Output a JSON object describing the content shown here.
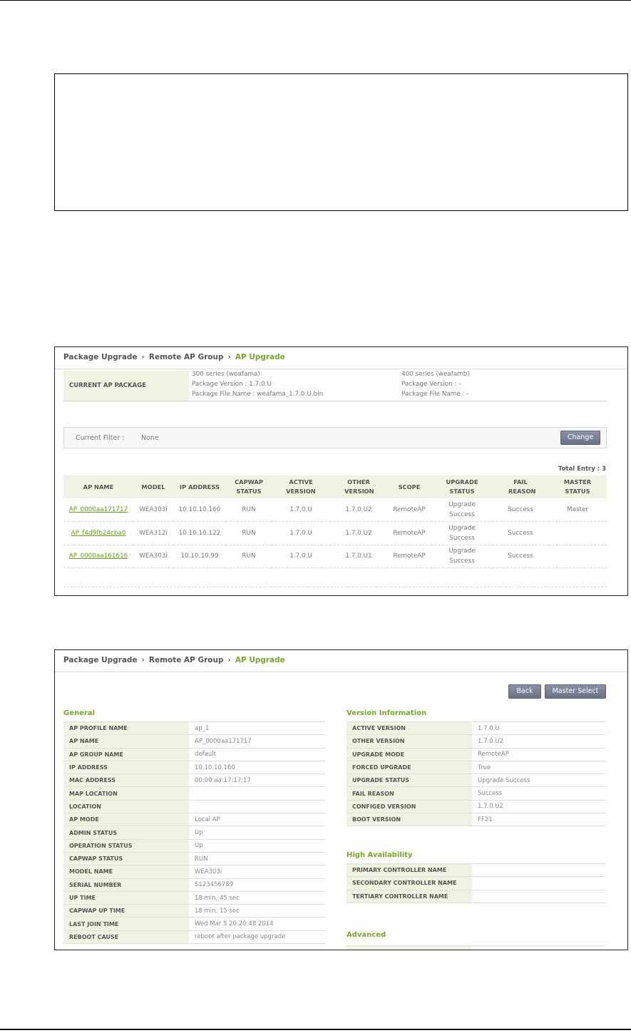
{
  "panel1": {
    "breadcrumb": [
      "Package Upgrade",
      "Remote AP Group",
      "AP Upgrade"
    ],
    "current_package_label": "CURRENT AP PACKAGE",
    "pkg300": [
      "300 series (weafama)",
      "Package Version : 1.7.0.U",
      "Package File Name : weafama_1.7.0.U.bin"
    ],
    "pkg400": [
      "400 series (weafamb)",
      "Package Version : -",
      "Package File Name : -"
    ],
    "filter_label": "Current Filter :",
    "filter_value": "None",
    "change_button": "Change",
    "total_entry": "Total Entry : 3",
    "columns": [
      "AP NAME",
      "MODEL",
      "IP ADDRESS",
      "CAPWAP STATUS",
      "ACTIVE VERSION",
      "OTHER VERSION",
      "SCOPE",
      "UPGRADE STATUS",
      "FAIL REASON",
      "MASTER STATUS"
    ],
    "rows": [
      [
        "AP_0000aa171717",
        "WEA303i",
        "10.10.10.160",
        "RUN",
        "1.7.0.U",
        "1.7.0.U2",
        "RemoteAP",
        "Upgrade Success",
        "Success",
        "Master"
      ],
      [
        "AP_f4d9fb24cba0",
        "WEA312i",
        "10.10.10.122",
        "RUN",
        "1.7.0.U",
        "1.7.0.U2",
        "RemoteAP",
        "Upgrade Success",
        "Success",
        ""
      ],
      [
        "AP_0000aa161616",
        "WEA303i",
        "10.10.10.99",
        "RUN",
        "1.7.0.U",
        "1.7.0.U1",
        "RemoteAP",
        "Upgrade Success",
        "Success",
        ""
      ]
    ]
  },
  "panel2": {
    "breadcrumb": [
      "Package Upgrade",
      "Remote AP Group",
      "AP Upgrade"
    ],
    "back_button": "Back",
    "master_select_button": "Master Select",
    "general_title": "General",
    "general": [
      [
        "AP PROFILE NAME",
        "ap_1"
      ],
      [
        "AP NAME",
        "AP_0000aa171717"
      ],
      [
        "AP GROUP NAME",
        "default"
      ],
      [
        "IP ADDRESS",
        "10.10.10.160"
      ],
      [
        "MAC ADDRESS",
        "00:00:aa:17:17:17"
      ],
      [
        "MAP LOCATION",
        ""
      ],
      [
        "LOCATION",
        ""
      ],
      [
        "AP MODE",
        "Local AP"
      ],
      [
        "ADMIN STATUS",
        "Up"
      ],
      [
        "OPERATION STATUS",
        "Up"
      ],
      [
        "CAPWAP STATUS",
        "RUN"
      ],
      [
        "MODEL NAME",
        "WEA303i"
      ],
      [
        "SERIAL NUMBER",
        "S123456789"
      ],
      [
        "UP TIME",
        "18 min, 45 sec"
      ],
      [
        "CAPWAP UP TIME",
        "18 min, 15 sec"
      ],
      [
        "LAST JOIN TIME",
        "Wed Mar 5 20:20:48 2014"
      ],
      [
        "REBOOT CAUSE",
        "reboot after package upgrade"
      ]
    ],
    "version_title": "Version Information",
    "version": [
      [
        "ACTIVE VERSION",
        "1.7.0.U"
      ],
      [
        "OTHER VERSION",
        "1.7.0.U2"
      ],
      [
        "UPGRADE MODE",
        "RemoteAP"
      ],
      [
        "FORCED UPGRADE",
        "True"
      ],
      [
        "UPGRADE STATUS",
        "Upgrade Success"
      ],
      [
        "FAIL REASON",
        "Success"
      ],
      [
        "CONFIGED VERSION",
        "1.7.0.U2"
      ],
      [
        "BOOT VERSION",
        "FF21"
      ]
    ],
    "ha_title": "High Availability",
    "ha": [
      [
        "PRIMARY CONTROLLER NAME",
        ""
      ],
      [
        "SECONDARY CONTROLLER NAME",
        ""
      ],
      [
        "TERTIARY CONTROLLER NAME",
        ""
      ]
    ],
    "advanced_title": "Advanced"
  },
  "colors": {
    "accent_green": "#7aa52c",
    "label_bg": "#eef3e2",
    "link_green": "#6d9a1f",
    "button": "#7a8294"
  }
}
